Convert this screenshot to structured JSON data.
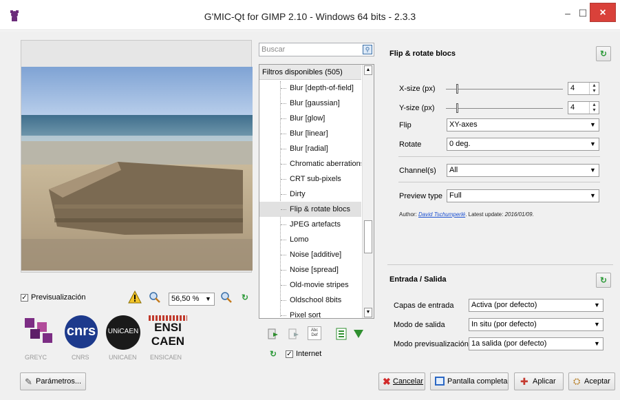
{
  "window": {
    "title": "G'MIC-Qt for GIMP 2.10 - Windows 64 bits - 2.3.3",
    "minimize": "–",
    "maximize": "☐",
    "close": "×"
  },
  "preview": {
    "checkbox_label": "Previsualización",
    "checked": true,
    "zoom_value": "56,50 %",
    "logos": [
      "GREYC",
      "CNRS",
      "UNICAEN",
      "ENSICAEN"
    ],
    "cnrs_text": "cnrs",
    "unicaen_text": "UNiCAEN",
    "ensi_text": "ENSI",
    "caen_text": "CAEN"
  },
  "filters": {
    "search_placeholder": "Buscar",
    "header": "Filtros disponibles (505)",
    "items": [
      "Blur [depth-of-field]",
      "Blur [gaussian]",
      "Blur [glow]",
      "Blur [linear]",
      "Blur [radial]",
      "Chromatic aberrations",
      "CRT sub-pixels",
      "Dirty",
      "Flip & rotate blocs",
      "JPEG artefacts",
      "Lomo",
      "Noise [additive]",
      "Noise [spread]",
      "Old-movie stripes",
      "Oldschool 8bits",
      "Pixel sort"
    ],
    "selected_index": 8,
    "internet_label": "Internet",
    "internet_checked": true,
    "abc_icon": "Abc Def"
  },
  "settings": {
    "title": "Flip & rotate blocs",
    "xsize_label": "X-size (px)",
    "xsize_value": "4",
    "ysize_label": "Y-size (px)",
    "ysize_value": "4",
    "flip_label": "Flip",
    "flip_value": "XY-axes",
    "rotate_label": "Rotate",
    "rotate_value": "0 deg.",
    "channels_label": "Channel(s)",
    "channels_value": "All",
    "preview_type_label": "Preview type",
    "preview_type_value": "Full",
    "author_prefix": "Author: ",
    "author_name": "David Tschumperlé",
    "author_suffix": ". Latest update: ",
    "author_date": "2016/01/09."
  },
  "io": {
    "title": "Entrada / Salida",
    "input_layers_label": "Capas de entrada",
    "input_layers_value": "Activa (por defecto)",
    "output_mode_label": "Modo de salida",
    "output_mode_value": "In situ (por defecto)",
    "preview_mode_label": "Modo previsualización",
    "preview_mode_value": "1a salida (por defecto)"
  },
  "buttons": {
    "parametros": "Parámetros...",
    "cancelar": "Cancelar",
    "pantalla_completa": "Pantalla completa",
    "aplicar": "Aplicar",
    "aceptar": "Aceptar"
  },
  "colors": {
    "close_red": "#d9413a",
    "refresh_green": "#2e9a3a",
    "link_blue": "#1a4fd0"
  }
}
